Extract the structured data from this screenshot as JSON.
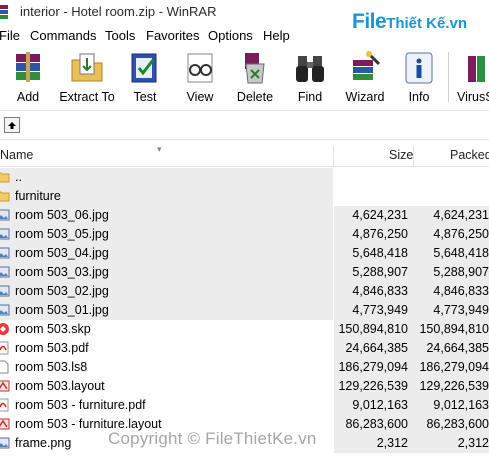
{
  "window": {
    "title": "interior - Hotel room.zip - WinRAR"
  },
  "watermark": {
    "logo_file": "File",
    "logo_rest": "Thiết Kế.vn",
    "copyright": "Copyright © FileThietKe.vn"
  },
  "menu": [
    "File",
    "Commands",
    "Tools",
    "Favorites",
    "Options",
    "Help"
  ],
  "toolbar": [
    {
      "label": "Add",
      "icon": "books-add-icon"
    },
    {
      "label": "Extract To",
      "icon": "folder-extract-icon"
    },
    {
      "label": "Test",
      "icon": "test-check-icon"
    },
    {
      "label": "View",
      "icon": "glasses-view-icon"
    },
    {
      "label": "Delete",
      "icon": "delete-recycle-icon"
    },
    {
      "label": "Find",
      "icon": "binoculars-find-icon"
    },
    {
      "label": "Wizard",
      "icon": "wizard-icon"
    },
    {
      "label": "Info",
      "icon": "info-icon"
    },
    {
      "label": "VirusS",
      "icon": "virus-scan-icon"
    }
  ],
  "columns": {
    "name": "Name",
    "size": "Size",
    "packed": "Packed"
  },
  "files": [
    {
      "name": "..",
      "type": "folder",
      "size": "",
      "packed": ""
    },
    {
      "name": "furniture",
      "type": "folder",
      "size": "",
      "packed": ""
    },
    {
      "name": "room 503_06.jpg",
      "type": "jpg",
      "size": "4,624,231",
      "packed": "4,624,231"
    },
    {
      "name": "room 503_05.jpg",
      "type": "jpg",
      "size": "4,876,250",
      "packed": "4,876,250"
    },
    {
      "name": "room 503_04.jpg",
      "type": "jpg",
      "size": "5,648,418",
      "packed": "5,648,418"
    },
    {
      "name": "room 503_03.jpg",
      "type": "jpg",
      "size": "5,288,907",
      "packed": "5,288,907"
    },
    {
      "name": "room 503_02.jpg",
      "type": "jpg",
      "size": "4,846,833",
      "packed": "4,846,833"
    },
    {
      "name": "room 503_01.jpg",
      "type": "jpg",
      "size": "4,773,949",
      "packed": "4,773,949"
    },
    {
      "name": "room 503.skp",
      "type": "skp",
      "size": "150,894,810",
      "packed": "150,894,810"
    },
    {
      "name": "room 503.pdf",
      "type": "pdf",
      "size": "24,664,385",
      "packed": "24,664,385"
    },
    {
      "name": "room 503.ls8",
      "type": "doc",
      "size": "186,279,094",
      "packed": "186,279,094"
    },
    {
      "name": "room 503.layout",
      "type": "layout",
      "size": "129,226,539",
      "packed": "129,226,539"
    },
    {
      "name": "room 503 - furniture.pdf",
      "type": "pdf",
      "size": "9,012,163",
      "packed": "9,012,163"
    },
    {
      "name": "room 503 - furniture.layout",
      "type": "layout",
      "size": "86,283,600",
      "packed": "86,283,600"
    },
    {
      "name": "frame.png",
      "type": "png",
      "size": "2,312",
      "packed": "2,312"
    }
  ]
}
